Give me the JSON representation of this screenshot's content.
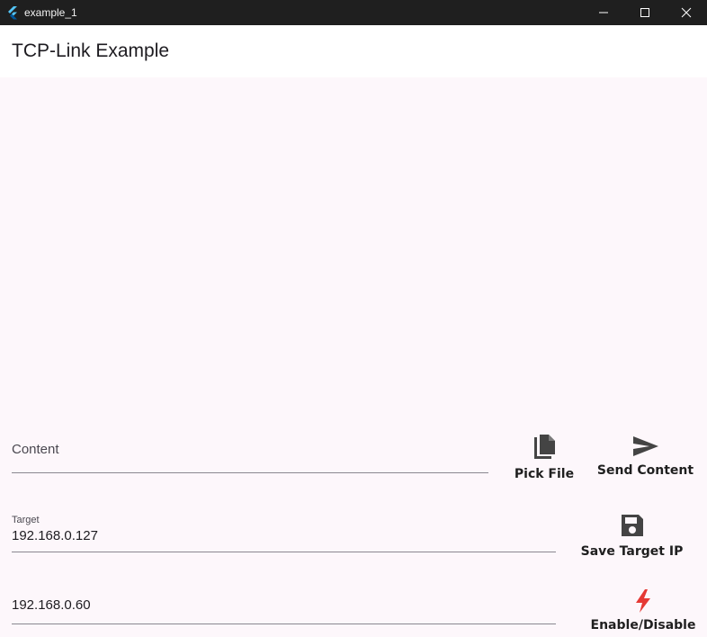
{
  "window": {
    "title": "example_1"
  },
  "appbar": {
    "title": "TCP-Link Example"
  },
  "content_field": {
    "placeholder": "Content",
    "value": ""
  },
  "target_field": {
    "label": "Target",
    "value": "192.168.0.127"
  },
  "ip_field": {
    "value": "192.168.0.60"
  },
  "buttons": {
    "pick_file": "Pick File",
    "send_content": "Send Content",
    "save_target": "Save Target IP",
    "enable_disable": "Enable/Disable"
  },
  "icons": {
    "pick_file": "file-copy-icon",
    "send_content": "send-icon",
    "save_target": "save-icon",
    "enable_disable": "bolt-icon"
  },
  "colors": {
    "titlebar": "#1f1f1f",
    "background": "#fdf7fb",
    "appbar": "#ffffff",
    "icon": "#444444",
    "bolt": "#e53935"
  }
}
